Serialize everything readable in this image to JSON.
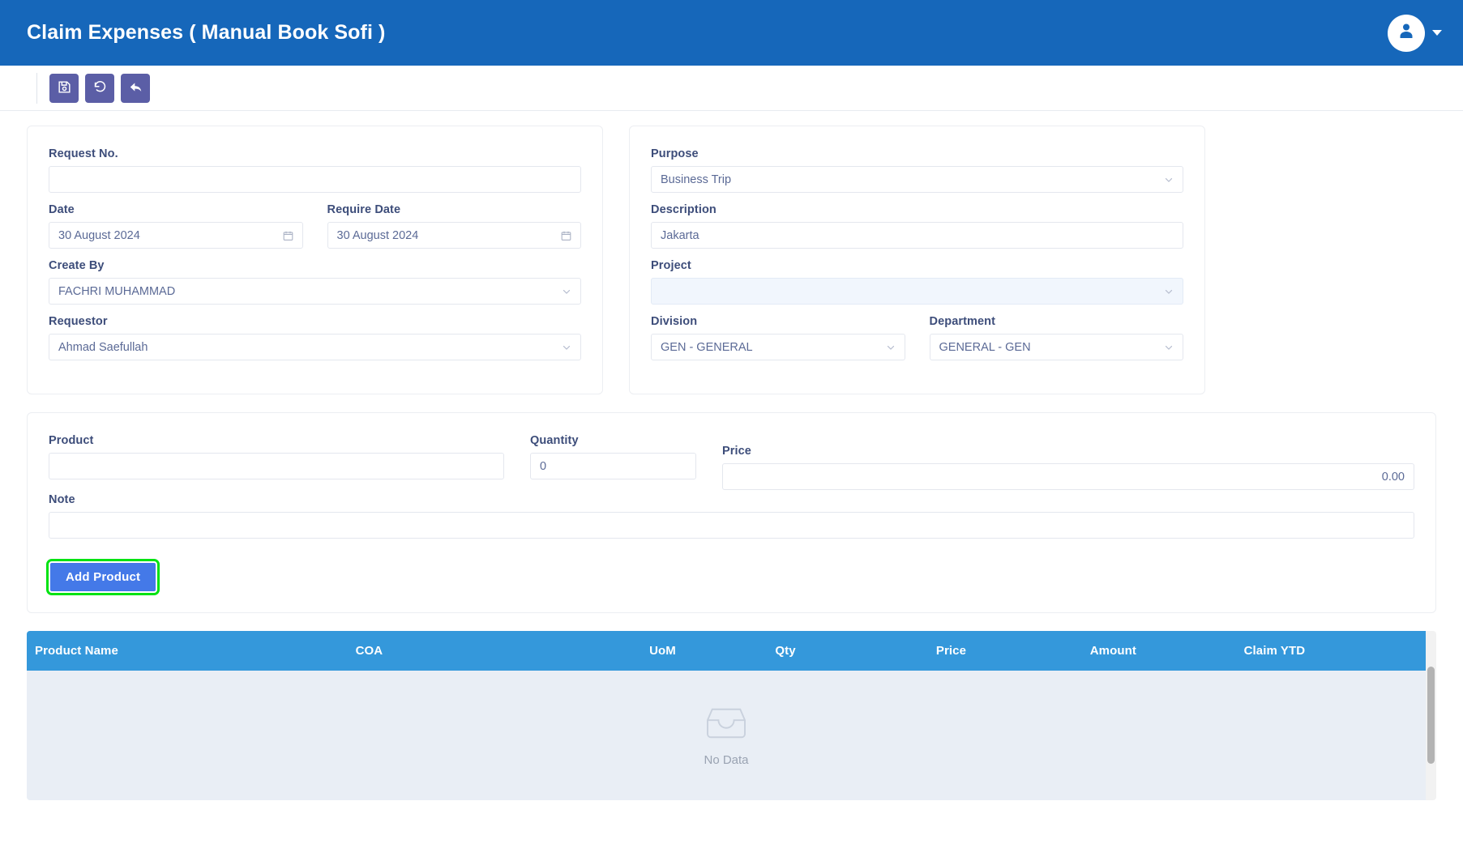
{
  "header": {
    "title": "Claim Expenses ( Manual Book Sofi )",
    "avatar_icon": "user-icon",
    "caret_icon": "chevron-down-icon"
  },
  "toolbar": {
    "save_icon": "save-floppy-icon",
    "reset_icon": "refresh-undo-icon",
    "back_icon": "back-arrow-icon"
  },
  "left_panel": {
    "request_no": {
      "label": "Request No.",
      "value": "",
      "placeholder": ""
    },
    "date": {
      "label": "Date",
      "value": "30 August 2024",
      "icon": "calendar-icon"
    },
    "require_date": {
      "label": "Require Date",
      "value": "30 August 2024",
      "icon": "calendar-icon"
    },
    "create_by": {
      "label": "Create By",
      "value": "FACHRI MUHAMMAD",
      "icon": "chevron-down-icon"
    },
    "requestor": {
      "label": "Requestor",
      "value": "Ahmad Saefullah",
      "icon": "chevron-down-icon"
    }
  },
  "right_panel": {
    "purpose": {
      "label": "Purpose",
      "value": "Business Trip",
      "icon": "chevron-down-icon"
    },
    "description": {
      "label": "Description",
      "value": "Jakarta"
    },
    "project": {
      "label": "Project",
      "value": "",
      "icon": "chevron-down-icon"
    },
    "division": {
      "label": "Division",
      "value": "GEN - GENERAL",
      "icon": "chevron-down-icon"
    },
    "department": {
      "label": "Department",
      "value": "GENERAL - GEN",
      "icon": "chevron-down-icon"
    }
  },
  "product_panel": {
    "product": {
      "label": "Product",
      "value": ""
    },
    "quantity": {
      "label": "Quantity",
      "value": "0"
    },
    "price": {
      "label": "Price",
      "value": "0.00"
    },
    "note": {
      "label": "Note",
      "value": ""
    },
    "add_button": "Add Product"
  },
  "table": {
    "columns": [
      "Product Name",
      "COA",
      "UoM",
      "Qty",
      "Price",
      "Amount",
      "Claim YTD"
    ],
    "rows": [],
    "empty_text": "No Data",
    "empty_icon": "empty-tray-icon"
  },
  "colors": {
    "header_blue": "#1667ba",
    "toolbar_button": "#5b5ea6",
    "table_header_blue": "#3498db",
    "accent_button": "#4479e8",
    "highlight_green": "#00e312",
    "label_navy": "#3d4d7a"
  }
}
